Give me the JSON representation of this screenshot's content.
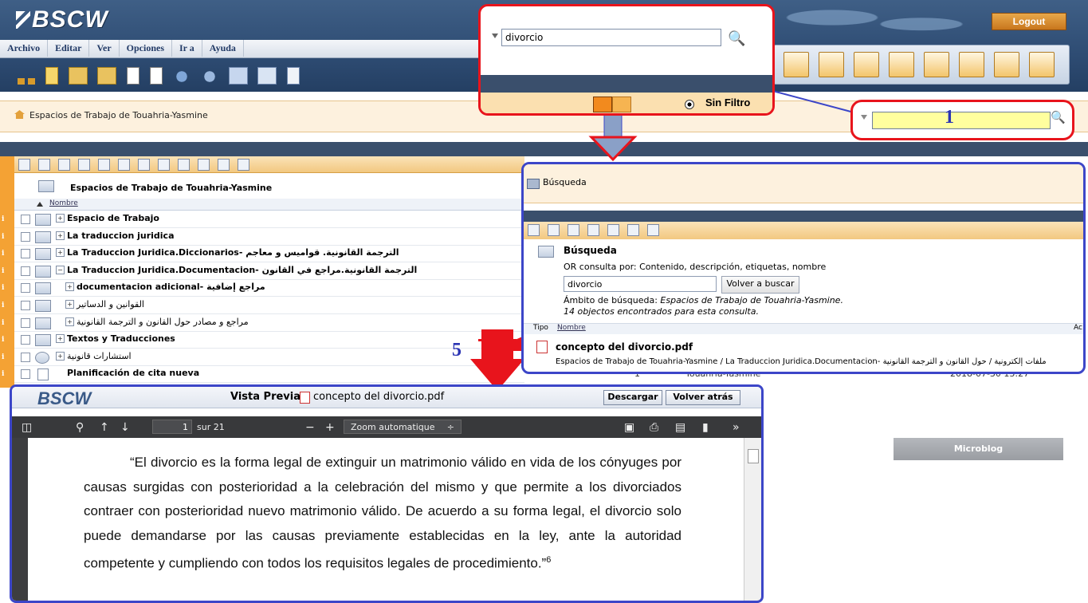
{
  "app": {
    "logo": "BSCW",
    "logout": "Logout"
  },
  "menu": [
    "Archivo",
    "Editar",
    "Ver",
    "Opciones",
    "Ir a",
    "Ayuda"
  ],
  "breadcrumb": "Espacios de Trabajo de Touahria-Yasmine",
  "search_callout": {
    "value": "divorcio",
    "filter": "Sin Filtro"
  },
  "small_search": {
    "value": "",
    "step": "1"
  },
  "tree": {
    "title": "Espacios de Trabajo de Touahria-Yasmine",
    "column": "Nombre",
    "rows": [
      {
        "label": "Espacio de Trabajo",
        "bold": true
      },
      {
        "label": "La traduccion juridica",
        "bold": true
      },
      {
        "label": "La Traduccion Juridica.Diccionarios- الترجمة القانونية. قواميس و معاجم",
        "bold": true
      },
      {
        "label": "La Traduccion Juridica.Documentacion- الترجمة القانونية.مراجع في القانون",
        "bold": true
      },
      {
        "label": "documentacion adicional- مراجع إضافية",
        "bold": true
      },
      {
        "label": "القوانين و الدساتير",
        "bold": false
      },
      {
        "label": "مراجع و مصادر حول القانون و الترجمة القانونية",
        "bold": false
      },
      {
        "label": "Textos y Traducciones",
        "bold": true
      },
      {
        "label": "استشارات قانونية",
        "bold": false
      },
      {
        "label": "Planificación de cita nueva",
        "bold": true
      }
    ]
  },
  "results": {
    "header": "Búsqueda",
    "title": "Búsqueda",
    "or_query": "OR consulta por: Contenido, descripción, etiquetas, nombre",
    "query": "divorcio",
    "again": "Volver a buscar",
    "scope_label": "Ámbito de búsqueda: ",
    "scope_value": "Espacios de Trabajo de Touahria-Yasmine.",
    "count": "14 objectos encontrados para esta consulta.",
    "col_tipo": "Tipo",
    "col_nombre": "Nombre",
    "col_ac": "Ac",
    "file": "concepto del divorcio.pdf",
    "path": "Espacios de Trabajo de Touahria-Yasmine / La Traduccion Juridica.Documentacion- ملفات إلكترونية / حول القانون و الترجمة القانونية"
  },
  "behind_row": {
    "num": "1",
    "owner": "Touahria-Yasmine",
    "date": "2018-07-30 13:27"
  },
  "step5": "5",
  "preview": {
    "logo": "BSCW",
    "label": "Vista Previa:",
    "file": "concepto del divorcio.pdf",
    "download": "Descargar",
    "back": "Volver atrás",
    "page": "1",
    "of": "sur 21",
    "zoom": "Zoom automatique",
    "text": "“El divorcio es la forma legal de extinguir un matrimonio válido en vida de los cónyuges por causas surgidas con posterioridad a la celebración del mismo y que permite a los divorciados contraer con posterioridad nuevo matrimonio válido. De acuerdo a su forma legal, el divorcio solo puede demandarse por las causas previamente establecidas en la ley, ante la autoridad competente y cumpliendo con todos los requisitos legales de procedimiento.”",
    "footnote": "6"
  },
  "microblog": "Microblog"
}
